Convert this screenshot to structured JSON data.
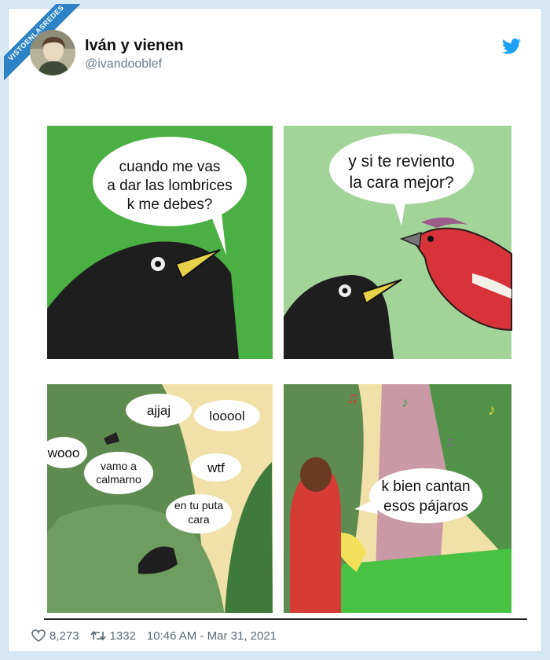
{
  "watermark": {
    "text": "VISTOENLASREDES",
    "sub": ".com"
  },
  "tweet": {
    "author_name": "Iván y vienen",
    "author_handle": "@ivandooblef",
    "likes": "8,273",
    "retweets": "1332",
    "timestamp": "10:46 AM - Mar 31, 2021"
  },
  "comic": {
    "panel1": {
      "lines": [
        "cuando me vas",
        "a dar las lombrices",
        "k me debes?"
      ]
    },
    "panel2": {
      "lines": [
        "y si te reviento",
        "la cara mejor?"
      ]
    },
    "panel3": {
      "ajjaj": "ajjaj",
      "looool": "looool",
      "wooo": "wooo",
      "vamo_line1": "vamo a",
      "vamo_line2": "calmarno",
      "wtf": "wtf",
      "puta_line1": "en tu puta",
      "puta_line2": "cara"
    },
    "panel4": {
      "lines": [
        "k bien cantan",
        "esos pájaros"
      ]
    }
  },
  "icons": {
    "logo": "twitter-bird-icon",
    "like": "heart-icon",
    "retweet": "retweet-icon"
  },
  "colors": {
    "brand": "#1da1f2",
    "ribbon": "#2d83c6",
    "panel_green": "#4bb044"
  }
}
